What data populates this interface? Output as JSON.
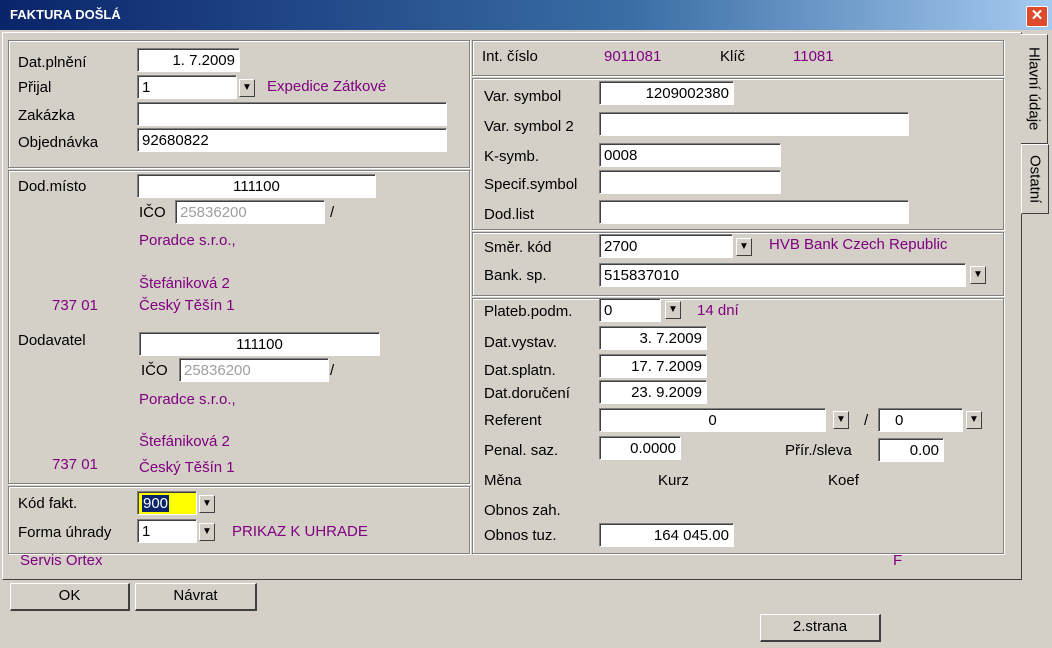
{
  "window": {
    "title": "FAKTURA DOŠLÁ",
    "close": "✕"
  },
  "tabs": [
    "Hlavní údaje",
    "Ostatní"
  ],
  "left": {
    "dat_plneni_label": "Dat.plnění",
    "dat_plneni": "1. 7.2009",
    "prijal_label": "Přijal",
    "prijal": "1",
    "prijal_name": "Expedice Zátkové",
    "zakazka_label": "Zakázka",
    "zakazka": "",
    "objednavka_label": "Objednávka",
    "objednavka": "92680822",
    "dod_misto_label": "Dod.místo",
    "dod_misto": "111100",
    "ico_label": "IČO",
    "dod_misto_ico": "25836200",
    "slash": "/",
    "dod_misto_name": "Poradce s.r.o.,",
    "dod_misto_street": "Štefániková 2",
    "dod_misto_zip": "737 01",
    "dod_misto_city": "Český Těšín 1",
    "dodavatel_label": "Dodavatel",
    "dodavatel": "111100",
    "dodavatel_ico": "25836200",
    "dodavatel_name": "Poradce s.r.o.,",
    "dodavatel_street": "Štefániková 2",
    "dodavatel_zip": "737 01",
    "dodavatel_city": "Český Těšín 1",
    "kod_fakt_label": "Kód fakt.",
    "kod_fakt": "900",
    "forma_uhrady_label": "Forma úhrady",
    "forma_uhrady": "1",
    "forma_uhrady_name": "PRIKAZ K UHRADE",
    "footer_left": "Servis Ortex"
  },
  "right": {
    "int_cislo_label": "Int. číslo",
    "int_cislo": "9011081",
    "klic_label": "Klíč",
    "klic": "11081",
    "var_symbol_label": "Var. symbol",
    "var_symbol": "1209002380",
    "var_symbol2_label": "Var. symbol 2",
    "var_symbol2": "",
    "k_symb_label": "K-symb.",
    "k_symb": "0008",
    "specif_label": "Specif.symbol",
    "specif": "",
    "dod_list_label": "Dod.list",
    "dod_list": "",
    "smer_kod_label": "Směr. kód",
    "smer_kod": "2700",
    "bank_name": "HVB Bank Czech Republic",
    "bank_sp_label": "Bank. sp.",
    "bank_sp": "515837010",
    "plateb_label": "Plateb.podm.",
    "plateb": "0",
    "plateb_days": "14 dní",
    "dat_vystav_label": "Dat.vystav.",
    "dat_vystav": "3. 7.2009",
    "dat_splatn_label": "Dat.splatn.",
    "dat_splatn": "17. 7.2009",
    "dat_doruc_label": "Dat.doručení",
    "dat_doruc": "23. 9.2009",
    "referent_label": "Referent",
    "referent": "0",
    "referent2": "0",
    "slash": "/",
    "penal_label": "Penal. saz.",
    "penal": "0.0000",
    "prir_label": "Přír./sleva",
    "prir": "0.00",
    "mena_label": "Měna",
    "kurz_label": "Kurz",
    "koef_label": "Koef",
    "obnos_zah_label": "Obnos zah.",
    "obnos_tuz_label": "Obnos tuz.",
    "obnos_tuz": "164 045.00",
    "footer_right": "F"
  },
  "buttons": {
    "ok": "OK",
    "navrat": "Návrat",
    "strana2": "2.strana"
  }
}
